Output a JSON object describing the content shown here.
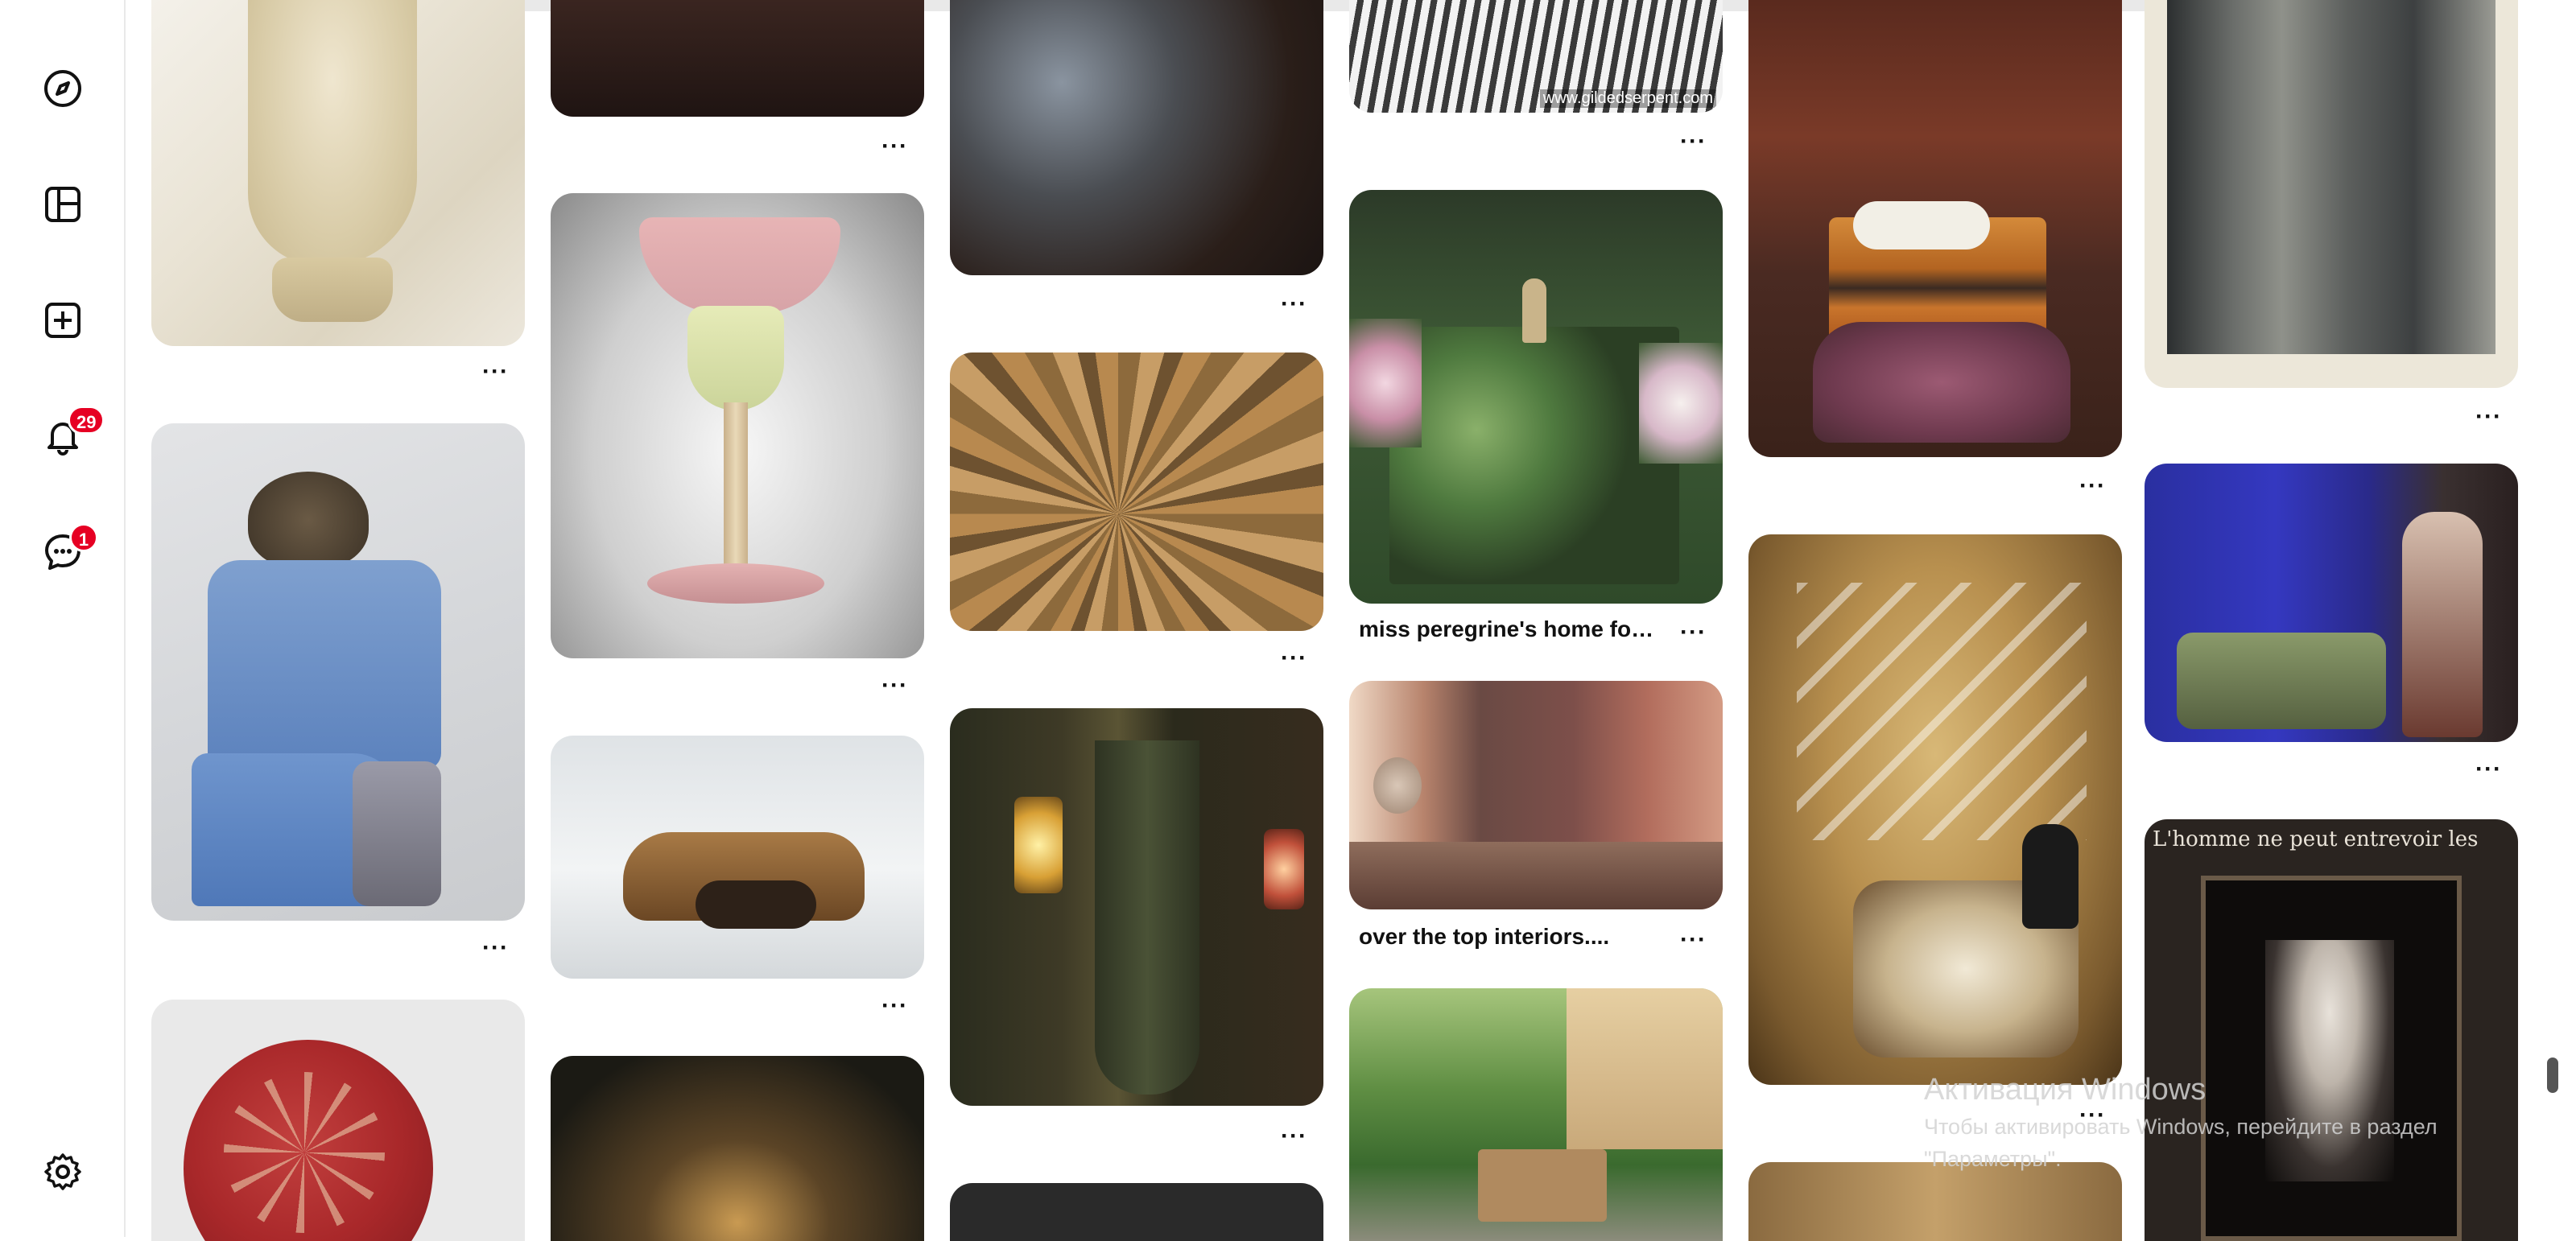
{
  "sidebar": {
    "explore_label": "explore",
    "boards_label": "boards",
    "create_label": "create",
    "notifications_badge": "29",
    "messages_badge": "1",
    "settings_label": "settings"
  },
  "pins": {
    "miss_peregrine": {
      "title": "miss peregrine's home for..."
    },
    "interiors": {
      "title": "over the top interiors...."
    }
  },
  "more_label": "···",
  "watermark_text": "www.gildedserpent.com",
  "engraved_text": "L'homme ne peut entrevoir les",
  "windows": {
    "title": "Активация Windows",
    "line1": "Чтобы активировать Windows, перейдите в раздел",
    "line2": "\"Параметры\"."
  },
  "colors": {
    "badge": "#e60023",
    "text": "#111111"
  }
}
